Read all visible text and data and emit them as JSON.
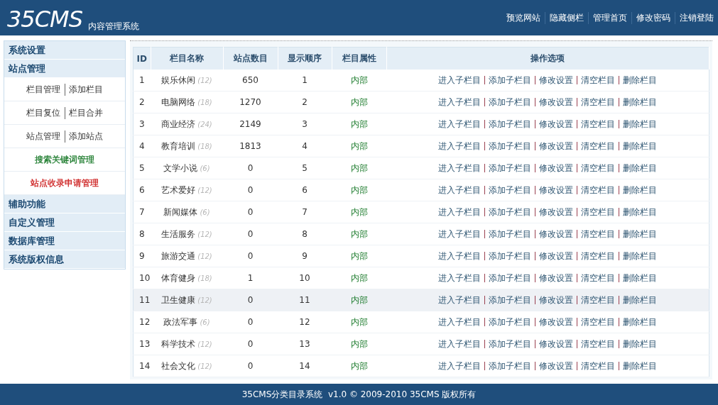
{
  "header": {
    "logo": "35CMS",
    "subtitle": "内容管理系统",
    "nav": [
      "预览网站",
      "隐藏侧栏",
      "管理首页",
      "修改密码",
      "注销登陆"
    ]
  },
  "sidebar": {
    "sections": [
      {
        "title": "系统设置"
      },
      {
        "title": "站点管理",
        "items": [
          {
            "links": [
              "栏目管理",
              "添加栏目"
            ]
          },
          {
            "links": [
              "栏目复位",
              "栏目合并"
            ]
          },
          {
            "links": [
              "站点管理",
              "添加站点"
            ]
          },
          {
            "links": [
              "搜索关键词管理"
            ],
            "color": "#1a7a2a"
          },
          {
            "links": [
              "站点收录申请管理"
            ],
            "color": "#cc1a1a"
          }
        ]
      },
      {
        "title": "辅助功能"
      },
      {
        "title": "自定义管理"
      },
      {
        "title": "数据库管理"
      },
      {
        "title": "系统版权信息"
      }
    ]
  },
  "table": {
    "columns": [
      "ID",
      "栏目名称",
      "站点数目",
      "显示顺序",
      "栏目属性",
      "操作选项"
    ],
    "rows": [
      {
        "id": "1",
        "name": "娱乐休闲",
        "sub_count": "(12)",
        "site_count": "650",
        "order": "1",
        "attribute": "内部",
        "selected": false,
        "actions": [
          "进入子栏目",
          "添加子栏目",
          "修改设置",
          "清空栏目",
          "删除栏目"
        ]
      },
      {
        "id": "2",
        "name": "电脑网络",
        "sub_count": "(18)",
        "site_count": "1270",
        "order": "2",
        "attribute": "内部",
        "selected": false,
        "actions": [
          "进入子栏目",
          "添加子栏目",
          "修改设置",
          "清空栏目",
          "删除栏目"
        ]
      },
      {
        "id": "3",
        "name": "商业经济",
        "sub_count": "(24)",
        "site_count": "2149",
        "order": "3",
        "attribute": "内部",
        "selected": false,
        "actions": [
          "进入子栏目",
          "添加子栏目",
          "修改设置",
          "清空栏目",
          "删除栏目"
        ]
      },
      {
        "id": "4",
        "name": "教育培训",
        "sub_count": "(18)",
        "site_count": "1813",
        "order": "4",
        "attribute": "内部",
        "selected": false,
        "actions": [
          "进入子栏目",
          "添加子栏目",
          "修改设置",
          "清空栏目",
          "删除栏目"
        ]
      },
      {
        "id": "5",
        "name": "文学小说",
        "sub_count": "(6)",
        "site_count": "0",
        "order": "5",
        "attribute": "内部",
        "selected": false,
        "actions": [
          "进入子栏目",
          "添加子栏目",
          "修改设置",
          "清空栏目",
          "删除栏目"
        ]
      },
      {
        "id": "6",
        "name": "艺术爱好",
        "sub_count": "(12)",
        "site_count": "0",
        "order": "6",
        "attribute": "内部",
        "selected": false,
        "actions": [
          "进入子栏目",
          "添加子栏目",
          "修改设置",
          "清空栏目",
          "删除栏目"
        ]
      },
      {
        "id": "7",
        "name": "新闻媒体",
        "sub_count": "(6)",
        "site_count": "0",
        "order": "7",
        "attribute": "内部",
        "selected": false,
        "actions": [
          "进入子栏目",
          "添加子栏目",
          "修改设置",
          "清空栏目",
          "删除栏目"
        ]
      },
      {
        "id": "8",
        "name": "生活服务",
        "sub_count": "(12)",
        "site_count": "0",
        "order": "8",
        "attribute": "内部",
        "selected": false,
        "actions": [
          "进入子栏目",
          "添加子栏目",
          "修改设置",
          "清空栏目",
          "删除栏目"
        ]
      },
      {
        "id": "9",
        "name": "旅游交通",
        "sub_count": "(12)",
        "site_count": "0",
        "order": "9",
        "attribute": "内部",
        "selected": false,
        "actions": [
          "进入子栏目",
          "添加子栏目",
          "修改设置",
          "清空栏目",
          "删除栏目"
        ]
      },
      {
        "id": "10",
        "name": "体育健身",
        "sub_count": "(18)",
        "site_count": "1",
        "order": "10",
        "attribute": "内部",
        "selected": false,
        "actions": [
          "进入子栏目",
          "添加子栏目",
          "修改设置",
          "清空栏目",
          "删除栏目"
        ]
      },
      {
        "id": "11",
        "name": "卫生健康",
        "sub_count": "(12)",
        "site_count": "0",
        "order": "11",
        "attribute": "内部",
        "selected": true,
        "actions": [
          "进入子栏目",
          "添加子栏目",
          "修改设置",
          "清空栏目",
          "删除栏目"
        ]
      },
      {
        "id": "12",
        "name": "政法军事",
        "sub_count": "(6)",
        "site_count": "0",
        "order": "12",
        "attribute": "内部",
        "selected": false,
        "actions": [
          "进入子栏目",
          "添加子栏目",
          "修改设置",
          "清空栏目",
          "删除栏目"
        ]
      },
      {
        "id": "13",
        "name": "科学技术",
        "sub_count": "(12)",
        "site_count": "0",
        "order": "13",
        "attribute": "内部",
        "selected": false,
        "actions": [
          "进入子栏目",
          "添加子栏目",
          "修改设置",
          "清空栏目",
          "删除栏目"
        ]
      },
      {
        "id": "14",
        "name": "社会文化",
        "sub_count": "(12)",
        "site_count": "0",
        "order": "14",
        "attribute": "内部",
        "selected": false,
        "actions": [
          "进入子栏目",
          "添加子栏目",
          "修改设置",
          "清空栏目",
          "删除栏目"
        ]
      }
    ]
  },
  "footer": "35CMS分类目录系统  v1.0 © 2009-2010 35CMS 版权所有"
}
